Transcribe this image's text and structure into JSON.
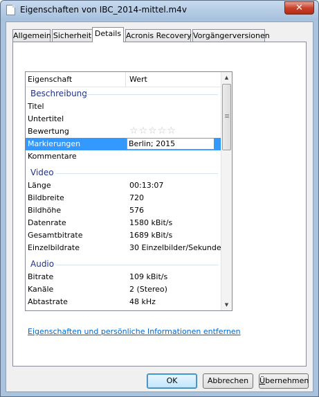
{
  "window": {
    "title": "Eigenschaften von IBC_2014-mittel.m4v",
    "close_glyph": "✕"
  },
  "tabs": [
    {
      "label": "Allgemein"
    },
    {
      "label": "Sicherheit"
    },
    {
      "label": "Details"
    },
    {
      "label": "Acronis Recovery"
    },
    {
      "label": "Vorgängerversionen"
    }
  ],
  "active_tab": "Details",
  "grid": {
    "col_property": "Eigenschaft",
    "col_value": "Wert"
  },
  "groups": {
    "description": {
      "label": "Beschreibung",
      "rows": [
        {
          "key": "Titel",
          "value": ""
        },
        {
          "key": "Untertitel",
          "value": ""
        },
        {
          "key": "Bewertung",
          "value": ""
        },
        {
          "key": "Markierungen",
          "value": "Berlin; 2015"
        },
        {
          "key": "Kommentare",
          "value": ""
        }
      ]
    },
    "video": {
      "label": "Video",
      "rows": [
        {
          "key": "Länge",
          "value": "00:13:07"
        },
        {
          "key": "Bildbreite",
          "value": "720"
        },
        {
          "key": "Bildhöhe",
          "value": "576"
        },
        {
          "key": "Datenrate",
          "value": "1580 kBit/s"
        },
        {
          "key": "Gesamtbitrate",
          "value": "1689 kBit/s"
        },
        {
          "key": "Einzelbildrate",
          "value": "30 Einzelbilder/Sekunde"
        }
      ]
    },
    "audio": {
      "label": "Audio",
      "rows": [
        {
          "key": "Bitrate",
          "value": "109 kBit/s"
        },
        {
          "key": "Kanäle",
          "value": "2 (Stereo)"
        },
        {
          "key": "Abtastrate",
          "value": "48 kHz"
        }
      ]
    }
  },
  "rating": {
    "stars": 0,
    "max": 5,
    "glyph": "☆"
  },
  "scrollbar": {
    "up_glyph": "▲",
    "down_glyph": "▼"
  },
  "remove_link": "Eigenschaften und persönliche Informationen entfernen",
  "buttons": {
    "ok": "OK",
    "cancel": "Abbrechen",
    "apply_first": "Ü",
    "apply_rest": "bernehmen"
  }
}
